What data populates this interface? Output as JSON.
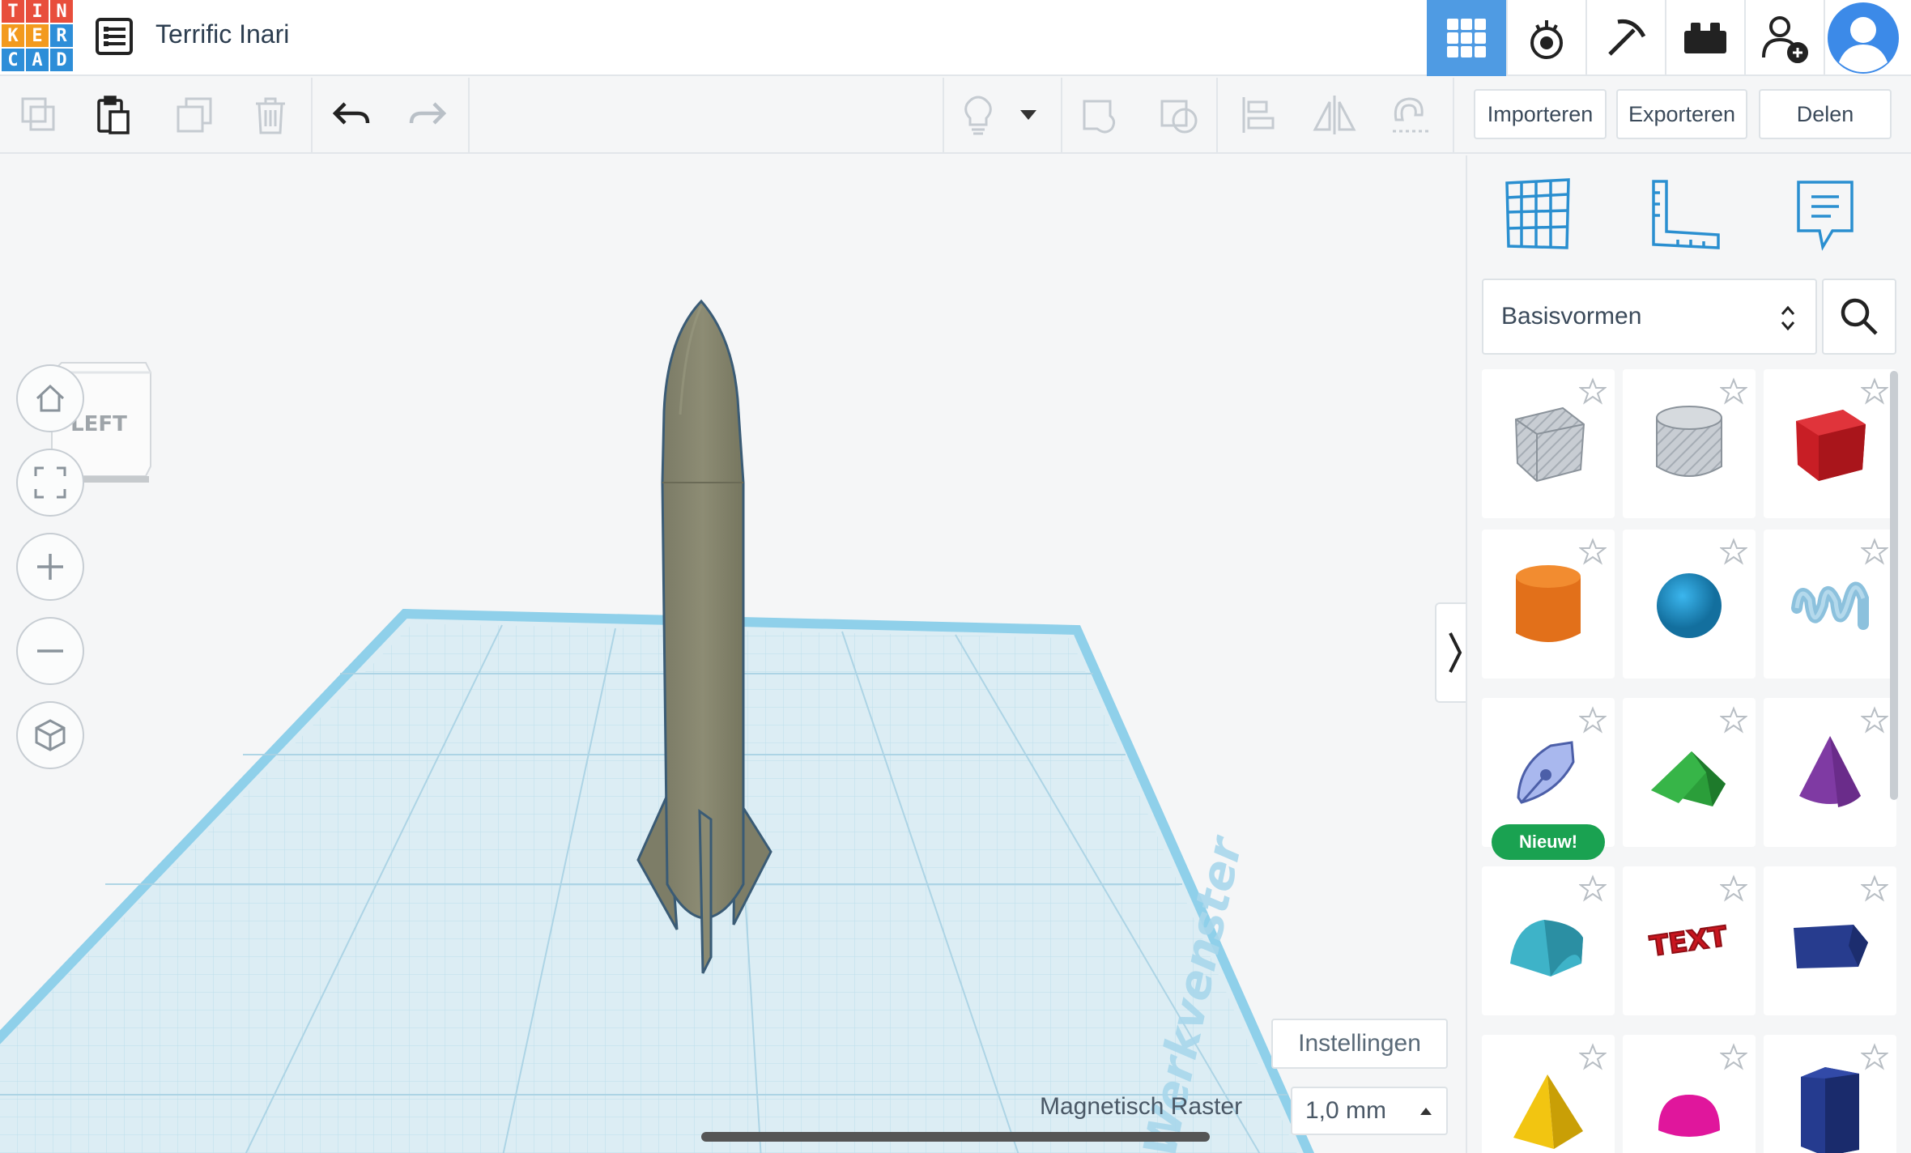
{
  "app": {
    "logo_letters": [
      "T",
      "I",
      "N",
      "K",
      "E",
      "R",
      "C",
      "A",
      "D"
    ],
    "logo_colors": [
      "#e84e3c",
      "#e84e3c",
      "#e84e3c",
      "#f39a1e",
      "#f39a1e",
      "#2d8ed8",
      "#2d8ed8",
      "#2d8ed8",
      "#2d8ed8"
    ],
    "project_title": "Terrific Inari",
    "accent": "#4f9be3"
  },
  "header_icons": [
    "grid-3d-icon",
    "sim-lab-icon",
    "minecraft-pickaxe-icon",
    "lego-brick-icon",
    "add-user-icon",
    "user-avatar-icon"
  ],
  "toolbar": {
    "import_label": "Importeren",
    "export_label": "Exporteren",
    "share_label": "Delen"
  },
  "viewport": {
    "viewcube_label": "LEFT",
    "workplane_watermark": "Werkvenster",
    "settings_label": "Instellingen",
    "snap_label": "Magnetisch Raster",
    "snap_value": "1,0 mm"
  },
  "panel": {
    "category": "Basisvormen",
    "new_badge": "Nieuw!",
    "shapes": [
      {
        "name": "Box hole",
        "color": "#b8bec6"
      },
      {
        "name": "Cylinder hole",
        "color": "#c4c9cf"
      },
      {
        "name": "Box",
        "color": "#d0212a"
      },
      {
        "name": "Cylinder",
        "color": "#e67617"
      },
      {
        "name": "Sphere",
        "color": "#1e9bd7"
      },
      {
        "name": "Scribble",
        "color": "#8cc1dd"
      },
      {
        "name": "Shape Generator",
        "color": "#a9b8ee"
      },
      {
        "name": "Roof",
        "color": "#2b9e3a"
      },
      {
        "name": "Cone",
        "color": "#7f3aa3"
      },
      {
        "name": "Round roof",
        "color": "#3eb3c8"
      },
      {
        "name": "Text",
        "color": "#c8161f"
      },
      {
        "name": "Wedge",
        "color": "#273c8e"
      },
      {
        "name": "Pyramid",
        "color": "#f2c511"
      },
      {
        "name": "Half sphere",
        "color": "#e0169c"
      },
      {
        "name": "Polygon",
        "color": "#253b8f"
      }
    ],
    "text_shape_label": "TEXT"
  }
}
